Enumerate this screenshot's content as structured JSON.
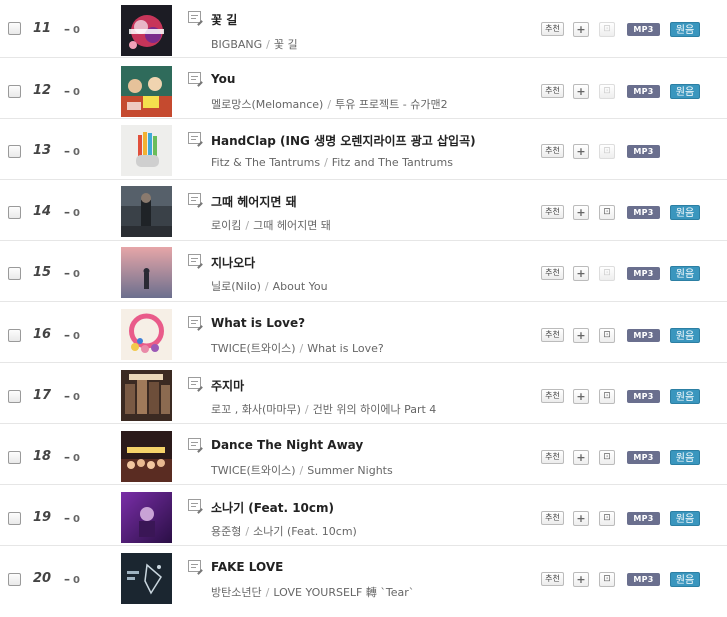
{
  "buttons": {
    "recommend_label": "추천",
    "add_label": "+",
    "mp3_label": "MP3",
    "original_label": "원음"
  },
  "icons": {
    "lyrics": "lyrics-icon",
    "download": "download-icon"
  },
  "rows": [
    {
      "rank": "11",
      "change": "0",
      "title": "꽃 길",
      "artist": "BIGBANG",
      "album": "꽃 길",
      "has_original": true,
      "download_active": false
    },
    {
      "rank": "12",
      "change": "0",
      "title": "You",
      "artist": "멜로망스(Melomance)",
      "album": "투유 프로젝트 - 슈가맨2",
      "has_original": true,
      "download_active": false
    },
    {
      "rank": "13",
      "change": "0",
      "title": "HandClap (ING 생명 오렌지라이프 광고 삽입곡)",
      "artist": "Fitz & The Tantrums",
      "album": "Fitz and The Tantrums",
      "has_original": false,
      "download_active": false
    },
    {
      "rank": "14",
      "change": "0",
      "title": "그때 헤어지면 돼",
      "artist": "로이킴",
      "album": "그때 헤어지면 돼",
      "has_original": true,
      "download_active": true
    },
    {
      "rank": "15",
      "change": "0",
      "title": "지나오다",
      "artist": "닐로(Nilo)",
      "album": "About You",
      "has_original": true,
      "download_active": false
    },
    {
      "rank": "16",
      "change": "0",
      "title": "What is Love?",
      "artist": "TWICE(트와이스)",
      "album": "What is Love?",
      "has_original": true,
      "download_active": true
    },
    {
      "rank": "17",
      "change": "0",
      "title": "주지마",
      "artist": "로꼬 , 화사(마마무)",
      "album": "건반 위의 하이에나 Part 4",
      "has_original": true,
      "download_active": true
    },
    {
      "rank": "18",
      "change": "0",
      "title": "Dance The Night Away",
      "artist": "TWICE(트와이스)",
      "album": "Summer Nights",
      "has_original": true,
      "download_active": true
    },
    {
      "rank": "19",
      "change": "0",
      "title": "소나기 (Feat. 10cm)",
      "artist": "용준형",
      "album": "소나기 (Feat. 10cm)",
      "has_original": true,
      "download_active": true
    },
    {
      "rank": "20",
      "change": "0",
      "title": "FAKE LOVE",
      "artist": "방탄소년단",
      "album": "LOVE YOURSELF 轉 `Tear`",
      "has_original": true,
      "download_active": true
    }
  ]
}
